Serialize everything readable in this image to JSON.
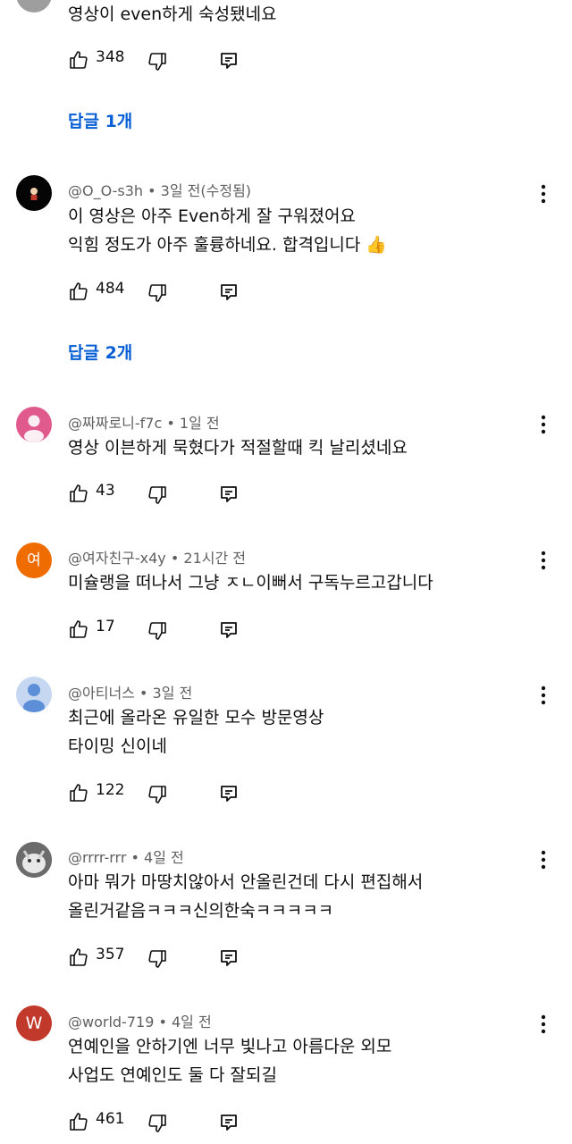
{
  "top_comment": {
    "text": "영상이 even하게 숙성됐네요",
    "likes": "348",
    "replies_label": "답글 1개"
  },
  "comments": [
    {
      "handle": "@O_O-s3h",
      "meta": "• 3일 전(수정됨)",
      "lines": [
        "이 영상은 아주 Even하게 잘 구워졌어요",
        " 익힘 정도가 아주 훌륭하네요. 합격입니다 👍"
      ],
      "likes": "484",
      "replies_label": "답글 2개"
    },
    {
      "handle": "@짜짜로니-f7c",
      "meta": "• 1일 전",
      "lines": [
        "영상 이븐하게 묵혔다가 적절할때 킥 날리셨네요"
      ],
      "likes": "43"
    },
    {
      "handle": "@여자친구-x4y",
      "meta": "• 21시간 전",
      "avatar_letter": "여",
      "lines": [
        "미슐랭을 떠나서 그냥 ㅈㄴ이뻐서 구독누르고갑니다"
      ],
      "likes": "17"
    },
    {
      "handle": "@아티너스",
      "meta": "• 3일 전",
      "lines": [
        "최근에 올라온 유일한 모수 방문영상",
        "타이밍 신이네"
      ],
      "likes": "122"
    },
    {
      "handle": "@rrrr-rrr",
      "meta": "• 4일 전",
      "lines": [
        "아마 뭐가 마땅치않아서 안올린건데 다시 편집해서",
        "올린거같음ㅋㅋㅋ신의한숙ㅋㅋㅋㅋㅋ"
      ],
      "likes": "357"
    },
    {
      "handle": "@world-719",
      "meta": "• 4일 전",
      "avatar_letter": "W",
      "lines": [
        "연예인을 안하기엔 너무 빛나고 아름다운 외모",
        "사업도 연예인도 둘 다 잘되길"
      ],
      "likes": "461"
    }
  ],
  "colors": {
    "link": "#065fd4",
    "meta": "#606060",
    "avatar_pink": "#e05a8e",
    "avatar_orange": "#ef6c00",
    "avatar_blue": "#5c8fd8",
    "avatar_red": "#c0392b"
  },
  "icons": [
    "thumbs-up-icon",
    "thumbs-down-icon",
    "reply-icon",
    "more-vert-icon"
  ]
}
